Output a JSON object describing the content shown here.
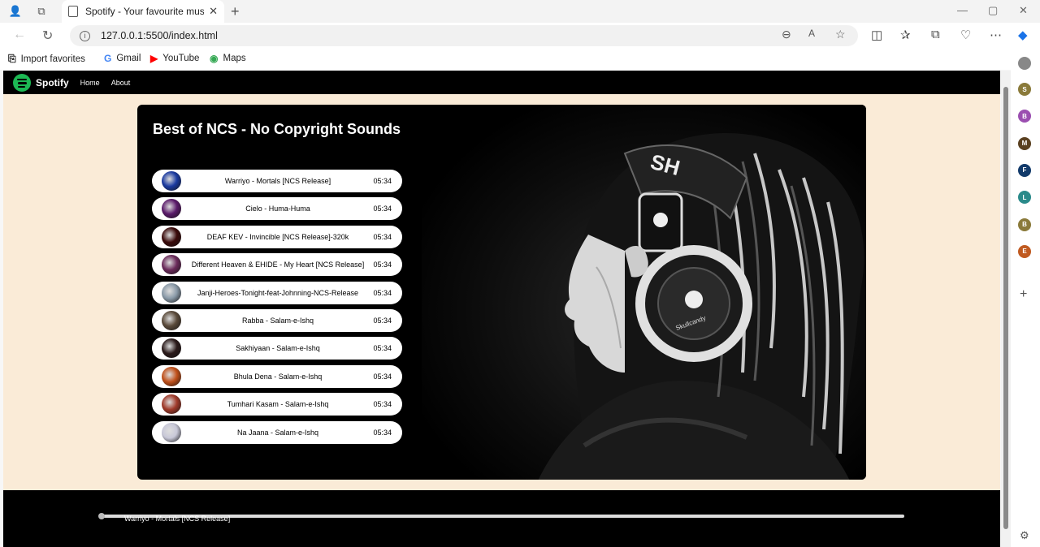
{
  "browser": {
    "tab_title": "Spotify - Your favourite music is",
    "url": "127.0.0.1:5500/index.html",
    "favorites": [
      {
        "label": "Import favorites",
        "icon": "import-icon"
      },
      {
        "label": "Gmail",
        "icon": "google-icon"
      },
      {
        "label": "YouTube",
        "icon": "youtube-icon"
      },
      {
        "label": "Maps",
        "icon": "maps-icon"
      }
    ],
    "sidebar_avatars": [
      {
        "letter": "S",
        "color": "#8a7a3a"
      },
      {
        "letter": "B",
        "color": "#9b4fb0"
      },
      {
        "letter": "M",
        "color": "#5a4020"
      },
      {
        "letter": "F",
        "color": "#123a6a"
      },
      {
        "letter": "L",
        "color": "#2a8a8a"
      },
      {
        "letter": "B",
        "color": "#8a7a3a"
      },
      {
        "letter": "E",
        "color": "#c05a20"
      }
    ]
  },
  "site": {
    "brand": "Spotify",
    "nav": [
      "Home",
      "About"
    ],
    "heading": "Best of NCS - No Copyright Sounds",
    "songs": [
      {
        "name": "Warriyo - Mortals [NCS Release]",
        "duration": "05:34",
        "cover_color": "#1a3aa0"
      },
      {
        "name": "Cielo - Huma-Huma",
        "duration": "05:34",
        "cover_color": "#5a1a6a"
      },
      {
        "name": "DEAF KEV - Invincible [NCS Release]-320k",
        "duration": "05:34",
        "cover_color": "#3a0a0a"
      },
      {
        "name": "Different Heaven & EHIDE - My Heart [NCS Release]",
        "duration": "05:34",
        "cover_color": "#6a2a5a"
      },
      {
        "name": "Janji-Heroes-Tonight-feat-Johnning-NCS-Release",
        "duration": "05:34",
        "cover_color": "#8a9aa8"
      },
      {
        "name": "Rabba - Salam-e-Ishq",
        "duration": "05:34",
        "cover_color": "#5a4a3a"
      },
      {
        "name": "Sakhiyaan - Salam-e-Ishq",
        "duration": "05:34",
        "cover_color": "#2a1a1a"
      },
      {
        "name": "Bhula Dena - Salam-e-Ishq",
        "duration": "05:34",
        "cover_color": "#c0501a"
      },
      {
        "name": "Tumhari Kasam - Salam-e-Ishq",
        "duration": "05:34",
        "cover_color": "#a03a2a"
      },
      {
        "name": "Na Jaana - Salam-e-Ishq",
        "duration": "05:34",
        "cover_color": "#c8c8d8"
      }
    ],
    "now_playing": "Warriyo - Mortals [NCS Release]",
    "progress": 0
  }
}
